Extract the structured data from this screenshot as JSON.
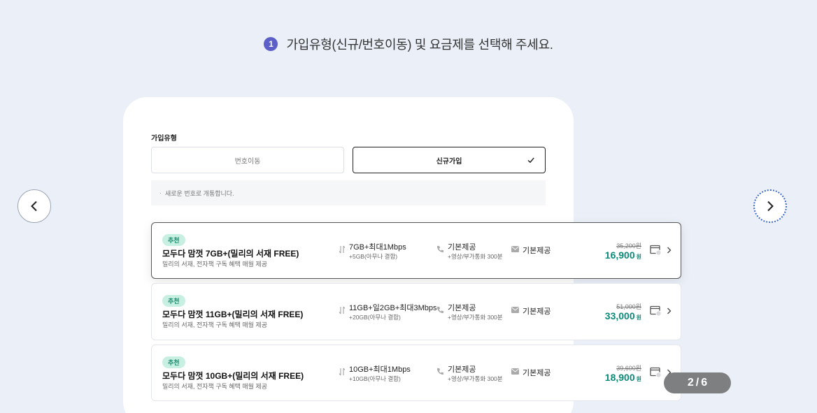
{
  "step": {
    "number": "1",
    "text": "가입유형(신규/번호이동) 및 요금제를 선택해 주세요."
  },
  "join_type": {
    "label": "가입유형",
    "options": [
      "번호이동",
      "신규가입"
    ],
    "selected": "신규가입",
    "notice": "새로운 번호로 개통합니다."
  },
  "plans": [
    {
      "badge": "추천",
      "name": "모두다 맘껏 7GB+(밀리의 서재 FREE)",
      "desc": "밀리의 서재, 전자책 구독 혜택 매월 제공",
      "data_main": "7GB+최대1Mbps",
      "data_sub": "+5GB(아무나 결합)",
      "call_main": "기본제공",
      "call_sub": "+영상/부가통화 300분",
      "sms": "기본제공",
      "original_price": "35,200원",
      "price": "16,900",
      "won": "원"
    },
    {
      "badge": "추천",
      "name": "모두다 맘껏 11GB+(밀리의 서재 FREE)",
      "desc": "밀리의 서재, 전자책 구독 혜택 매월 제공",
      "data_main": "11GB+일2GB+최대3Mbps",
      "data_sub": "+20GB(아무나 결합)",
      "call_main": "기본제공",
      "call_sub": "+영상/부가통화 300분",
      "sms": "기본제공",
      "original_price": "51,000원",
      "price": "33,000",
      "won": "원"
    },
    {
      "badge": "추천",
      "name": "모두다 맘껏 10GB+(밀리의 서재 FREE)",
      "desc": "밀리의 서재, 전자책 구독 혜택 매월 제공",
      "data_main": "10GB+최대1Mbps",
      "data_sub": "+10GB(아무나 결합)",
      "call_main": "기본제공",
      "call_sub": "+영상/부가통화 300분",
      "sms": "기본제공",
      "original_price": "39,600원",
      "price": "18,900",
      "won": "원"
    }
  ],
  "pager": {
    "current": "2",
    "separator": "/",
    "total": "6"
  },
  "colors": {
    "accent": "#5b5fc7",
    "price": "#0c8a78",
    "badge_bg": "#c8f0e2",
    "badge_text": "#17876a",
    "background": "#ebf0f8"
  },
  "icons": {
    "prev": "chevron-left-icon",
    "next": "chevron-right-icon",
    "data": "data-transfer-icon",
    "call": "phone-icon",
    "sms": "mail-icon",
    "compare": "compare-icon",
    "detail": "chevron-right-icon",
    "check": "check-icon"
  }
}
